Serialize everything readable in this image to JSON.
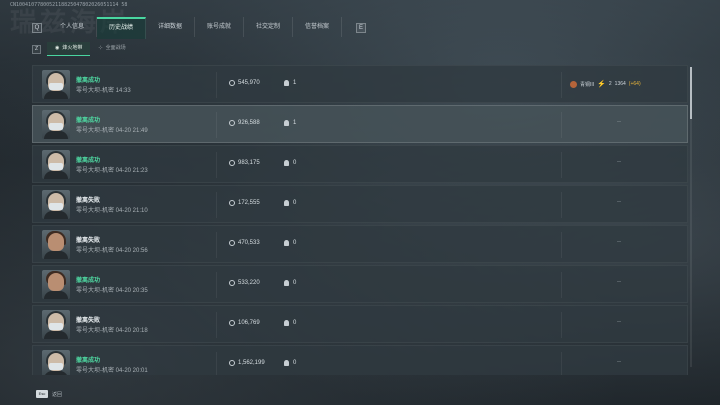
{
  "watermark": "CN1004107780052118825047802026051114 58",
  "bg_title": "瑞兹海岸",
  "nav": {
    "left_key": "Q",
    "right_key": "E",
    "tabs": [
      {
        "label": "个人信息",
        "active": false
      },
      {
        "label": "历史战绩",
        "active": true
      },
      {
        "label": "详细数据",
        "active": false
      },
      {
        "label": "账号成就",
        "active": false
      },
      {
        "label": "社交定制",
        "active": false
      },
      {
        "label": "信誉档案",
        "active": false
      }
    ]
  },
  "subnav": {
    "key": "Z",
    "tabs": [
      {
        "label": "烽火地带",
        "active": true
      },
      {
        "label": "全面战场",
        "active": false
      }
    ]
  },
  "matches": [
    {
      "result": "撤离成功",
      "success": true,
      "map": "零号大坝-机密 14:33",
      "coins": "545,970",
      "kills": "1",
      "rank_name": "青铜III",
      "rank_stars": "2",
      "rank_score": "1364",
      "rank_delta": "(+64)",
      "avatar": "masked",
      "highlight": false
    },
    {
      "result": "撤离成功",
      "success": true,
      "map": "零号大坝-机密 04-20 21:49",
      "coins": "926,588",
      "kills": "1",
      "extra": "--",
      "avatar": "masked",
      "highlight": true
    },
    {
      "result": "撤离成功",
      "success": true,
      "map": "零号大坝-机密 04-20 21:23",
      "coins": "983,175",
      "kills": "0",
      "extra": "--",
      "avatar": "masked",
      "highlight": false
    },
    {
      "result": "撤离失败",
      "success": false,
      "map": "零号大坝-机密 04-20 21:10",
      "coins": "172,555",
      "kills": "0",
      "extra": "--",
      "avatar": "masked",
      "highlight": false
    },
    {
      "result": "撤离失败",
      "success": false,
      "map": "零号大坝-机密 04-20 20:56",
      "coins": "470,533",
      "kills": "0",
      "extra": "--",
      "avatar": "female",
      "highlight": false
    },
    {
      "result": "撤离成功",
      "success": true,
      "map": "零号大坝-机密 04-20 20:35",
      "coins": "533,220",
      "kills": "0",
      "extra": "--",
      "avatar": "female",
      "highlight": false
    },
    {
      "result": "撤离失败",
      "success": false,
      "map": "零号大坝-机密 04-20 20:18",
      "coins": "106,769",
      "kills": "0",
      "extra": "--",
      "avatar": "masked",
      "highlight": false
    },
    {
      "result": "撤离成功",
      "success": true,
      "map": "零号大坝-机密 04-20 20:01",
      "coins": "1,562,199",
      "kills": "0",
      "extra": "--",
      "avatar": "masked",
      "highlight": false
    }
  ],
  "footer": {
    "esc_key": "Esc",
    "back_label": "返回"
  },
  "colors": {
    "accent": "#49d6a0",
    "success": "#4fd9a2",
    "rank_gold": "#e9b53a"
  }
}
